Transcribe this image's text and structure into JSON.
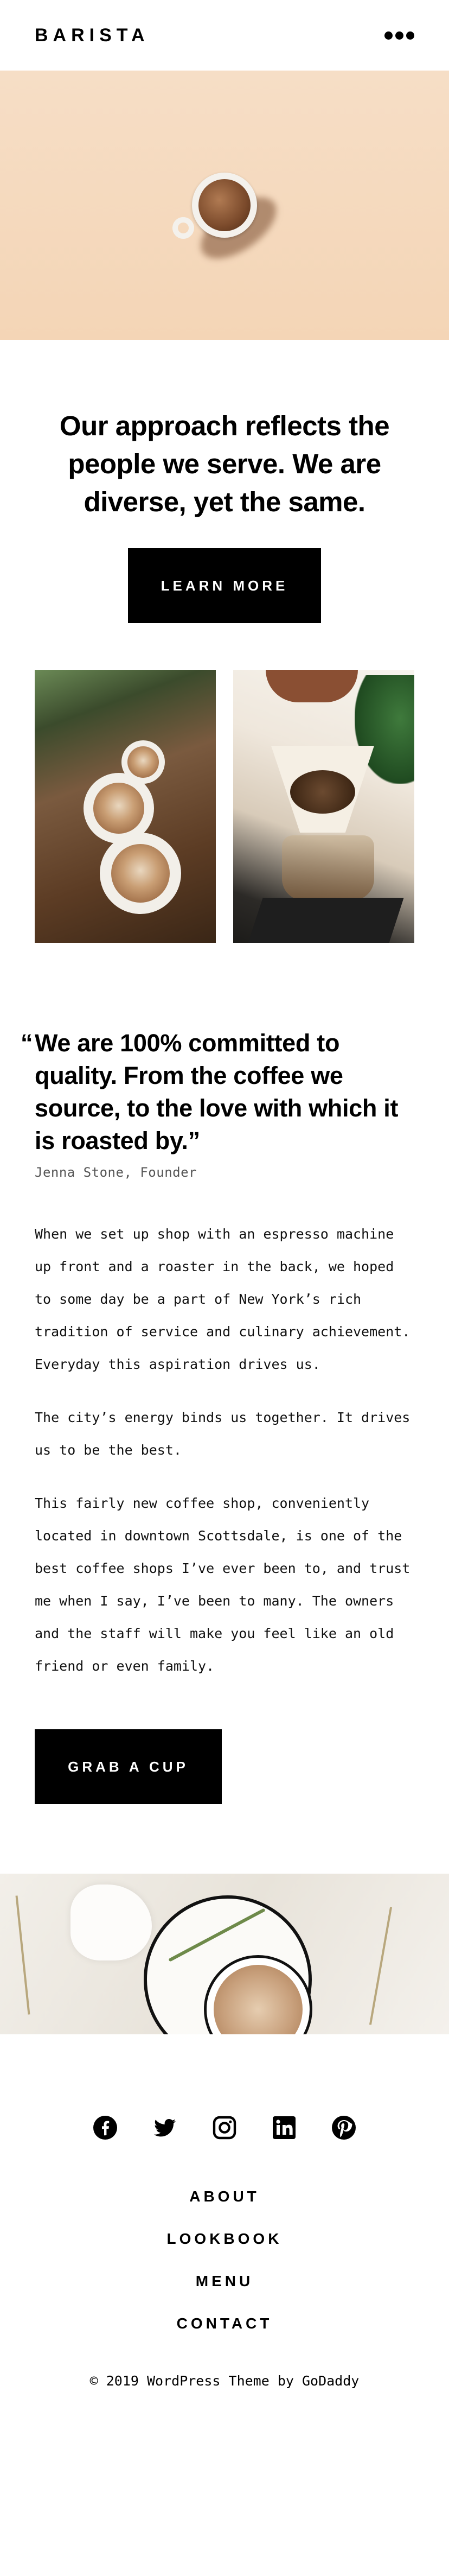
{
  "header": {
    "logo": "BARISTA",
    "menu_icon": "more-dots-icon"
  },
  "hero": {
    "image": "coffee-cup-on-peach-background"
  },
  "intro": {
    "heading": "Our approach reflects the people we serve. We are diverse, yet the same.",
    "button_label": "LEARN MORE"
  },
  "photos": [
    "latte-art-cups-on-wooden-table",
    "pour-over-coffee-dripper"
  ],
  "quote": {
    "open_mark": "“",
    "text": "We are 100% committed to quality. From the coffee we source, to the love with which it is roasted by.”",
    "author": "Jenna Stone, Founder"
  },
  "body": {
    "paragraphs": [
      "When we set up shop with an espresso machine up front and a roaster in the back, we hoped to some day be a part of New York’s rich tradition of service and culinary achievement. Everyday this aspiration drives us.",
      "The city’s energy binds us together. It drives us to be the best.",
      "This fairly new coffee shop, conveniently located in downtown Scottsdale, is one of the best coffee shops I’ve ever been to, and trust me when I say, I’ve been to many. The owners and the staff will make you feel like an old friend or even family."
    ],
    "button_label": "GRAB A CUP"
  },
  "table_photo": "latte-on-white-table-with-plants",
  "social": [
    {
      "name": "facebook-icon"
    },
    {
      "name": "twitter-icon"
    },
    {
      "name": "instagram-icon"
    },
    {
      "name": "linkedin-icon"
    },
    {
      "name": "pinterest-icon"
    }
  ],
  "footer": {
    "nav": [
      "ABOUT",
      "LOOKBOOK",
      "MENU",
      "CONTACT"
    ],
    "copyright": "© 2019  WordPress Theme by GoDaddy"
  }
}
